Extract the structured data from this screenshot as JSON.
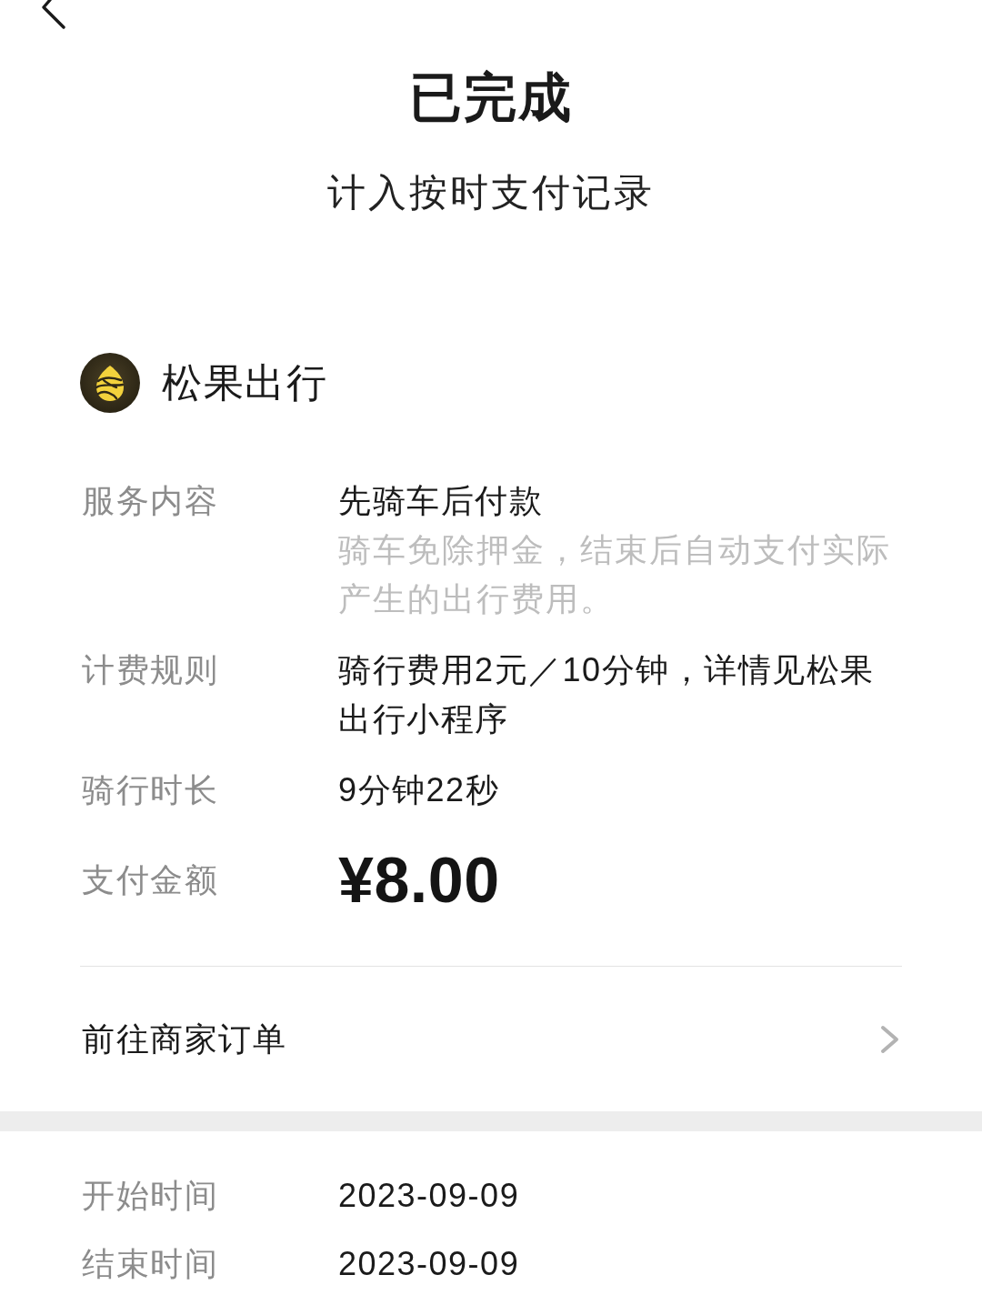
{
  "header": {
    "title": "已完成",
    "subtitle": "计入按时支付记录"
  },
  "merchant": {
    "name": "松果出行"
  },
  "details": [
    {
      "kind": "text",
      "label": "服务内容",
      "value": "先骑车后付款",
      "note": "骑车免除押金，结束后自动支付实际产生的出行费用。"
    },
    {
      "kind": "text",
      "label": "计费规则",
      "value": "骑行费用2元／10分钟，详情见松果出行小程序"
    },
    {
      "kind": "text",
      "label": "骑行时长",
      "value": "9分钟22秒"
    },
    {
      "kind": "amount",
      "label": "支付金额",
      "value": "¥8.00"
    }
  ],
  "merchant_link": {
    "label": "前往商家订单"
  },
  "times": [
    {
      "label": "开始时间",
      "value": "2023-09-09"
    },
    {
      "label": "结束时间",
      "value": "2023-09-09"
    }
  ]
}
